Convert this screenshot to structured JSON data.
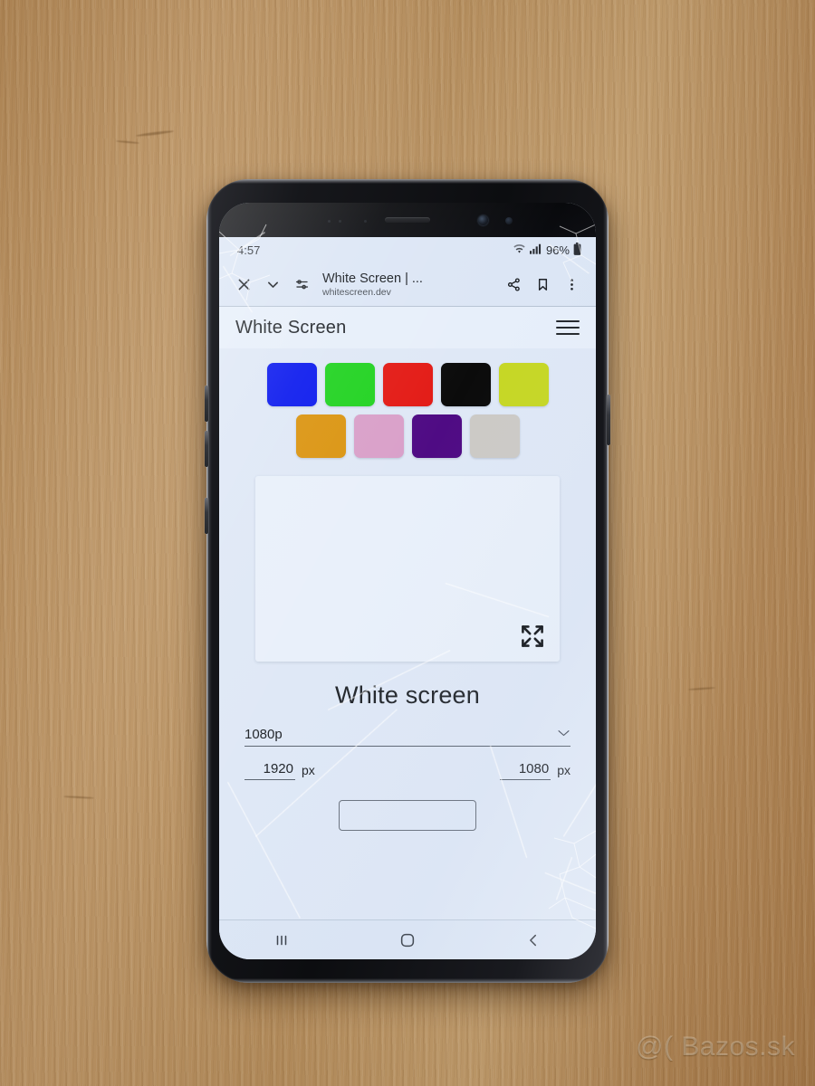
{
  "scene": {
    "watermark": "@( Bazos.sk",
    "desk_color": "#b28a59"
  },
  "phone": {
    "device": "samsung-galaxy-s8",
    "frame_color": "#16171b",
    "buttons": [
      {
        "name": "volume-up"
      },
      {
        "name": "volume-down"
      },
      {
        "name": "bixby"
      },
      {
        "name": "power"
      }
    ]
  },
  "statusbar": {
    "time": "4:57",
    "wifi_icon": "wifi-icon",
    "signal_icon": "signal-bars-icon",
    "battery_percent": "96%",
    "battery_icon": "battery-icon"
  },
  "browser_bar": {
    "close_icon": "close-icon",
    "chevron_icon": "chevron-down-icon",
    "page_info_icon": "tune-icon",
    "title": "White Screen | ...",
    "url": "whitescreen.dev",
    "share_icon": "share-icon",
    "bookmark_icon": "bookmark-icon",
    "overflow_icon": "more-vertical-icon"
  },
  "site_header": {
    "title": "White Screen",
    "menu_icon": "hamburger-menu-icon"
  },
  "swatches": {
    "row1": [
      {
        "name": "blue",
        "hex": "#0C1AEE"
      },
      {
        "name": "green",
        "hex": "#22D322"
      },
      {
        "name": "red",
        "hex": "#E31B16"
      },
      {
        "name": "black",
        "hex": "#0B0B0B"
      },
      {
        "name": "yellow-green",
        "hex": "#C6D724"
      }
    ],
    "row2": [
      {
        "name": "orange",
        "hex": "#DB9512"
      },
      {
        "name": "pink",
        "hex": "#D9A0C9"
      },
      {
        "name": "purple",
        "hex": "#4F0B84"
      },
      {
        "name": "light-gray",
        "hex": "#CCCAC6"
      }
    ]
  },
  "preview": {
    "background_hex": "#E9F0FA",
    "expand_icon": "fullscreen-expand-icon"
  },
  "content": {
    "heading": "White screen",
    "resolution_select": {
      "value": "1080p",
      "caret_icon": "chevron-down-icon",
      "options": [
        "1080p"
      ]
    },
    "width": {
      "value": "1920",
      "unit": "px"
    },
    "height": {
      "value": "1080",
      "unit": "px"
    }
  },
  "navbar": {
    "recents_icon": "recents-icon",
    "home_icon": "home-icon",
    "back_icon": "back-icon"
  }
}
